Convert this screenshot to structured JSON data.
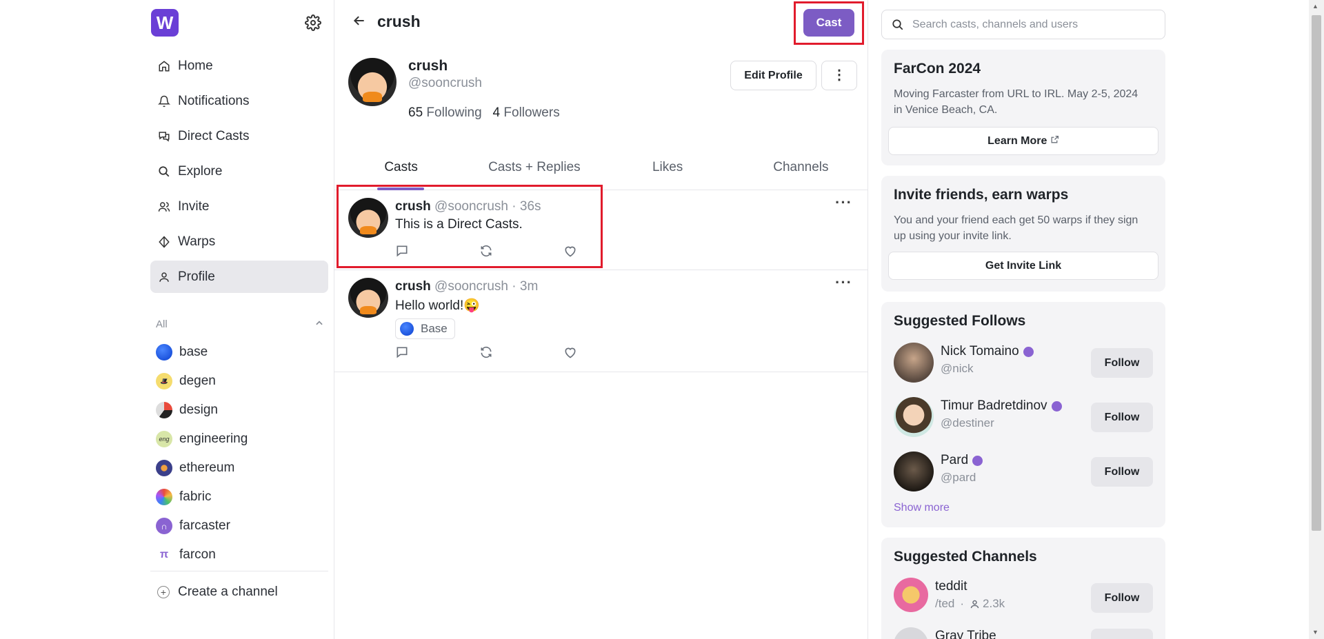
{
  "app": {
    "logo_letter": "W"
  },
  "sidebar": {
    "nav": [
      {
        "label": "Home",
        "icon": "home-icon"
      },
      {
        "label": "Notifications",
        "icon": "bell-icon"
      },
      {
        "label": "Direct Casts",
        "icon": "chat-icon"
      },
      {
        "label": "Explore",
        "icon": "search-icon"
      },
      {
        "label": "Invite",
        "icon": "users-icon"
      },
      {
        "label": "Warps",
        "icon": "diamond-icon"
      },
      {
        "label": "Profile",
        "icon": "user-icon",
        "active": true
      }
    ],
    "channels_header": "All",
    "channels": [
      {
        "label": "base",
        "color": "#0a52ff"
      },
      {
        "label": "degen",
        "color": "#f5dc6e"
      },
      {
        "label": "design",
        "color": "#222222"
      },
      {
        "label": "engineering",
        "color": "#d8e6a8",
        "glyph": "eng"
      },
      {
        "label": "ethereum",
        "color": "#3b3f8a"
      },
      {
        "label": "fabric",
        "color": "#ffffff"
      },
      {
        "label": "farcaster",
        "color": "#8a63d2"
      },
      {
        "label": "farcon",
        "color": "#ffffff"
      }
    ],
    "create_channel": "Create a channel"
  },
  "topbar": {
    "title": "crush",
    "cast_button": "Cast"
  },
  "profile": {
    "name": "crush",
    "handle": "@sooncrush",
    "following_count": "65",
    "following_label": "Following",
    "followers_count": "4",
    "followers_label": "Followers",
    "edit_button": "Edit Profile"
  },
  "tabs": [
    "Casts",
    "Casts + Replies",
    "Likes",
    "Channels"
  ],
  "casts": [
    {
      "name": "crush",
      "handle": "@sooncrush",
      "time": "· 36s",
      "text": "This is a Direct Casts."
    },
    {
      "name": "crush",
      "handle": "@sooncrush",
      "time": "· 3m",
      "text": "Hello world!😜",
      "channel": "Base"
    }
  ],
  "right": {
    "search_placeholder": "Search casts, channels and users",
    "farcon": {
      "title": "FarCon 2024",
      "text": "Moving Farcaster from URL to IRL. May 2-5, 2024 in Venice Beach, CA.",
      "button": "Learn More"
    },
    "invite": {
      "title": "Invite friends, earn warps",
      "text": "You and your friend each get 50 warps if they sign up using your invite link.",
      "button": "Get Invite Link"
    },
    "suggested_follows": {
      "title": "Suggested Follows",
      "users": [
        {
          "name": "Nick Tomaino",
          "handle": "@nick",
          "button": "Follow"
        },
        {
          "name": "Timur Badretdinov",
          "handle": "@destiner",
          "button": "Follow"
        },
        {
          "name": "Pard",
          "handle": "@pard",
          "button": "Follow"
        }
      ],
      "show_more": "Show more"
    },
    "suggested_channels": {
      "title": "Suggested Channels",
      "channels": [
        {
          "name": "teddit",
          "path": "/ted",
          "separator": "·",
          "members": "2.3k",
          "button": "Follow"
        },
        {
          "name": "Gray Tribe"
        }
      ]
    }
  },
  "colors": {
    "accent": "#7c5cc4",
    "highlight_box": "#e11b2c"
  }
}
